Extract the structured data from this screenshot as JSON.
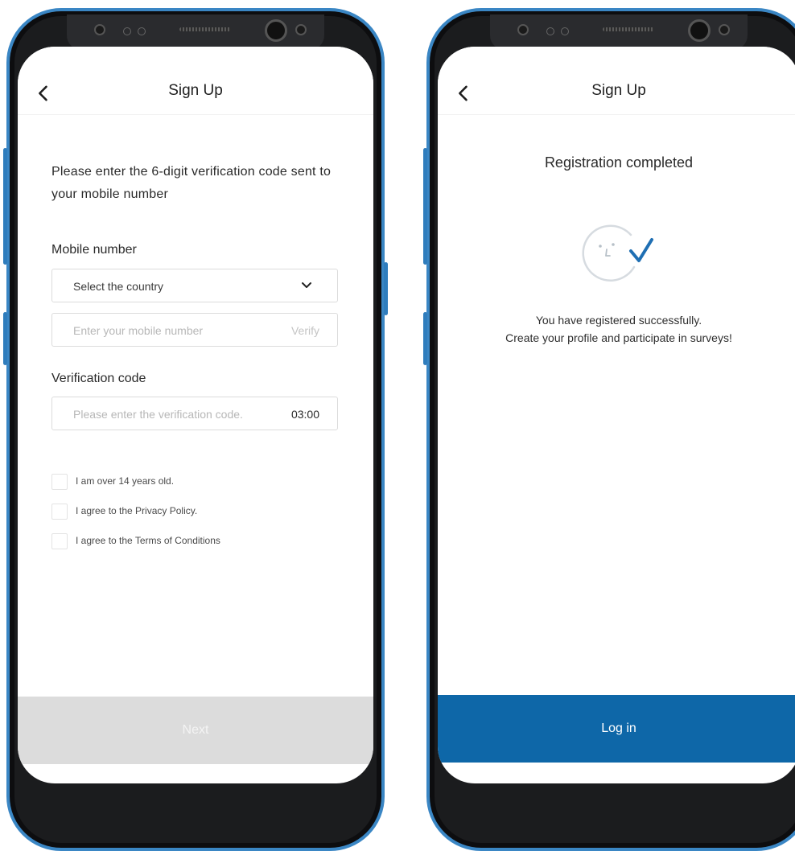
{
  "colors": {
    "phone_frame_accent": "#3a86c4",
    "primary_button": "#0e67a8",
    "disabled_button": "#dcdcdc",
    "check_accent": "#1f6fb3"
  },
  "left_screen": {
    "header": {
      "back_icon": "chevron-left-icon",
      "title": "Sign Up"
    },
    "instruction": "Please enter the 6-digit verification code sent to your mobile number",
    "mobile": {
      "label": "Mobile number",
      "country_select": {
        "value": "Select the country",
        "icon": "chevron-down-icon"
      },
      "number_input": {
        "placeholder": "Enter your mobile number",
        "action": "Verify"
      }
    },
    "verification": {
      "label": "Verification code",
      "input": {
        "placeholder": "Please enter the verification code.",
        "timer": "03:00"
      }
    },
    "agreements": [
      {
        "label": "I am over 14 years old.",
        "checked": false
      },
      {
        "label": "I agree to the Privacy Policy.",
        "checked": false
      },
      {
        "label": "I agree to the Terms of Conditions",
        "checked": false
      }
    ],
    "next_button": "Next"
  },
  "right_screen": {
    "header": {
      "back_icon": "chevron-left-icon",
      "title": "Sign Up"
    },
    "title": "Registration completed",
    "icon": "smiley-check-icon",
    "message_line1": "You have registered successfully.",
    "message_line2": "Create your profile and participate in surveys!",
    "login_button": "Log in"
  }
}
